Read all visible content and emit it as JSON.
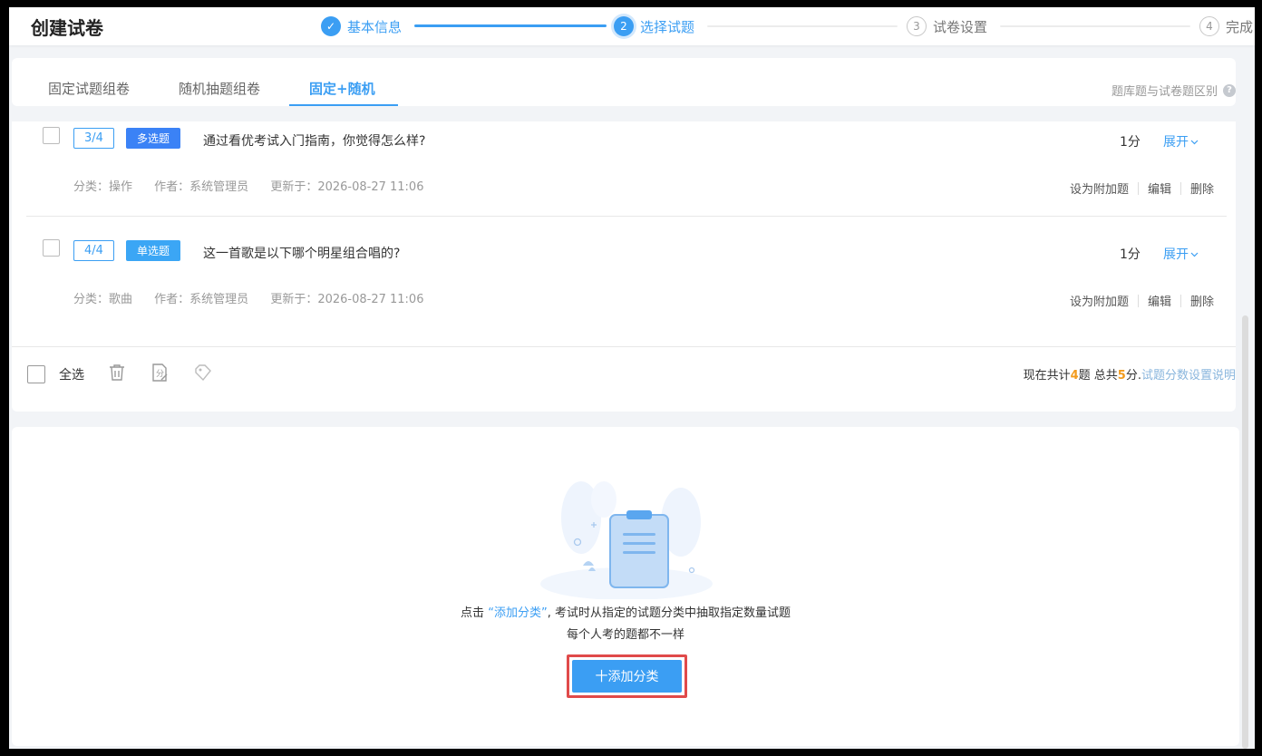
{
  "header": {
    "title": "创建试卷",
    "steps": [
      {
        "num": "✓",
        "label": "基本信息",
        "state": "done"
      },
      {
        "num": "2",
        "label": "选择试题",
        "state": "active"
      },
      {
        "num": "3",
        "label": "试卷设置",
        "state": "todo"
      },
      {
        "num": "4",
        "label": "完成",
        "state": "todo"
      }
    ]
  },
  "tabs": {
    "items": [
      "固定试题组卷",
      "随机抽题组卷",
      "固定+随机"
    ],
    "active_index": 2,
    "help_label": "题库题与试卷题区别",
    "help_icon": "?"
  },
  "questions": [
    {
      "count": "3/4",
      "type": "多选题",
      "type_color": "#3b82f6",
      "text": "通过看优考试入门指南，你觉得怎么样?",
      "score": "1分",
      "expand": "展开",
      "category": "分类：操作",
      "author": "作者：系统管理员",
      "updated": "更新于：2026-08-27 11:06",
      "actions": [
        "设为附加题",
        "编辑",
        "删除"
      ]
    },
    {
      "count": "4/4",
      "type": "单选题",
      "type_color": "#3ba6f5",
      "text": "这一首歌是以下哪个明星组合唱的?",
      "score": "1分",
      "expand": "展开",
      "category": "分类：歌曲",
      "author": "作者：系统管理员",
      "updated": "更新于：2026-08-27 11:06",
      "actions": [
        "设为附加题",
        "编辑",
        "删除"
      ]
    }
  ],
  "footer": {
    "select_all": "全选",
    "summary_prefix": "现在共计",
    "total_questions": "4",
    "summary_mid": "题 总共",
    "total_score": "5",
    "summary_suffix": "分.",
    "summary_link": "试题分数设置说明"
  },
  "empty": {
    "line1_prefix": "点击",
    "line1_link": "“添加分类”",
    "line1_suffix": ", 考试时从指定的试题分类中抽取指定数量试题",
    "line2": "每个人考的题都不一样",
    "add_button": "十添加分类"
  },
  "colors": {
    "accent": "#3b9ef3",
    "highlight_number": "#f29b1d",
    "focus_border": "#e04a4a"
  }
}
